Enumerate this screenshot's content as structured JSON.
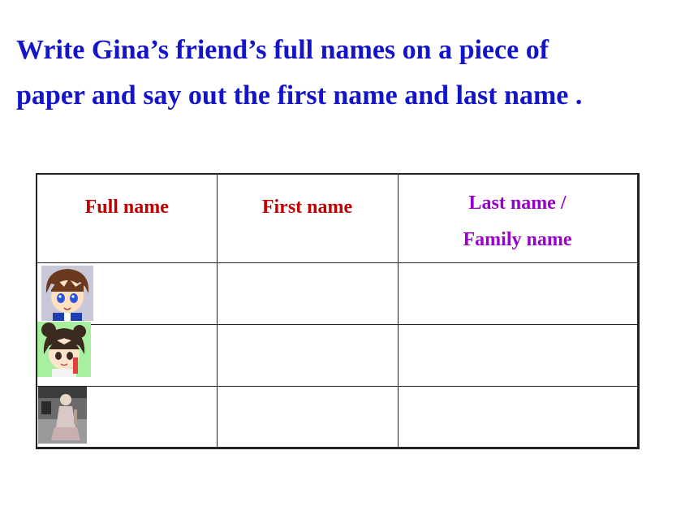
{
  "instruction": {
    "line1": "Write Gina’s friend’s full names on a piece of",
    "line2": "paper and say out the first name and last name ."
  },
  "table": {
    "headers": {
      "full_name": "Full name",
      "first_name": "First name",
      "last_name_line1": "Last name /",
      "last_name_line2": "Family name"
    },
    "rows": [
      {
        "avatar": "anime-boy-portrait-icon",
        "first_name": "",
        "last_name": ""
      },
      {
        "avatar": "anime-girl-portrait-icon",
        "first_name": "",
        "last_name": ""
      },
      {
        "avatar": "woman-photo-portrait",
        "first_name": "",
        "last_name": ""
      }
    ]
  },
  "colors": {
    "instruction": "#1414c8",
    "header_red": "#c00000",
    "header_purple": "#9900cc"
  }
}
